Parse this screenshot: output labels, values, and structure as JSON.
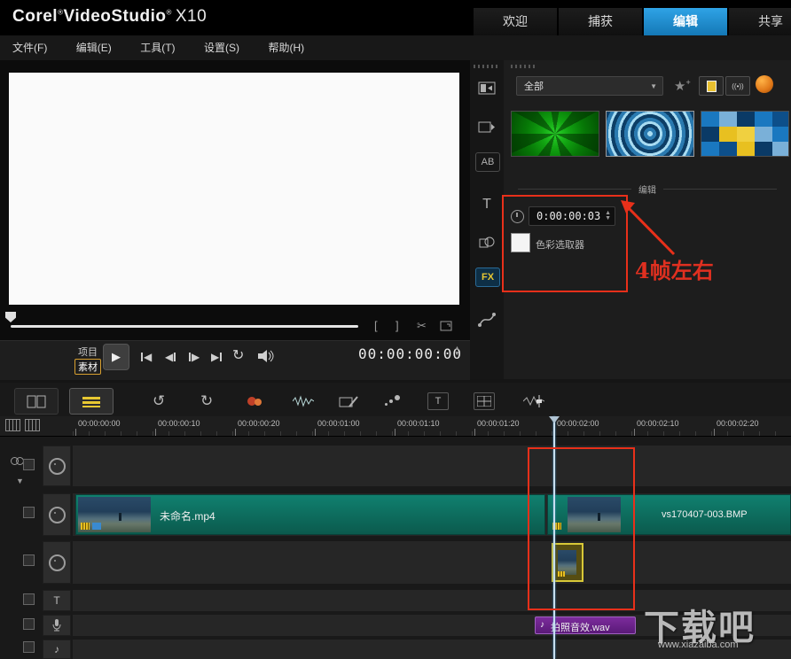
{
  "header": {
    "logo": {
      "brand": "Corel",
      "reg": "®",
      "product": "VideoStudio",
      "version": "X10"
    },
    "tabs": [
      {
        "label": "欢迎",
        "active": false
      },
      {
        "label": "捕获",
        "active": false
      },
      {
        "label": "编辑",
        "active": true
      },
      {
        "label": "共享",
        "active": false
      }
    ]
  },
  "menu": {
    "items": [
      {
        "label": "文件(F)"
      },
      {
        "label": "编辑(E)"
      },
      {
        "label": "工具(T)"
      },
      {
        "label": "设置(S)"
      },
      {
        "label": "帮助(H)"
      }
    ]
  },
  "preview": {
    "mode_project": "项目",
    "mode_clip": "素材",
    "timecode": "00:00:00:00"
  },
  "steps": {
    "ab": "AB",
    "fx": "FX"
  },
  "library": {
    "filter_value": "全部",
    "section_title": "编辑",
    "effect_duration": "0:00:00:03",
    "color_picker_label": "色彩选取器"
  },
  "annotation": {
    "note": "4帧左右"
  },
  "timeline": {
    "ruler": [
      "00:00:00:00",
      "00:00:00:10",
      "00:00:00:20",
      "00:00:01:00",
      "00:00:01:10",
      "00:00:01:20",
      "00:00:02:00",
      "00:00:02:10",
      "00:00:02:20"
    ],
    "clips": {
      "video_main": "未命名.mp4",
      "video_bmp": "vs170407-003.BMP",
      "audio": "拍照音效.wav"
    }
  },
  "watermark": {
    "title": "下载吧",
    "url": "www.xiazaiba.com"
  },
  "colors": {
    "accent_blue": "#1b8ed8",
    "annotation_red": "#e8301a",
    "active_yellow": "#e8c832",
    "clip_teal": "#0f7a6a",
    "clip_purple": "#7a2a9a"
  },
  "icons": {
    "play": "▶",
    "prev": "◀",
    "next": "▶",
    "undo": "↺",
    "redo": "↻",
    "loop": "↻",
    "scissors": "✂",
    "mark_in": "[",
    "mark_out": "]",
    "star": "★",
    "plus": "+",
    "dropdown_arrow": "▼",
    "spin_up": "▲",
    "spin_down": "▼",
    "music_note": "♪",
    "letter_t": "T",
    "chevron_down": "▼"
  }
}
